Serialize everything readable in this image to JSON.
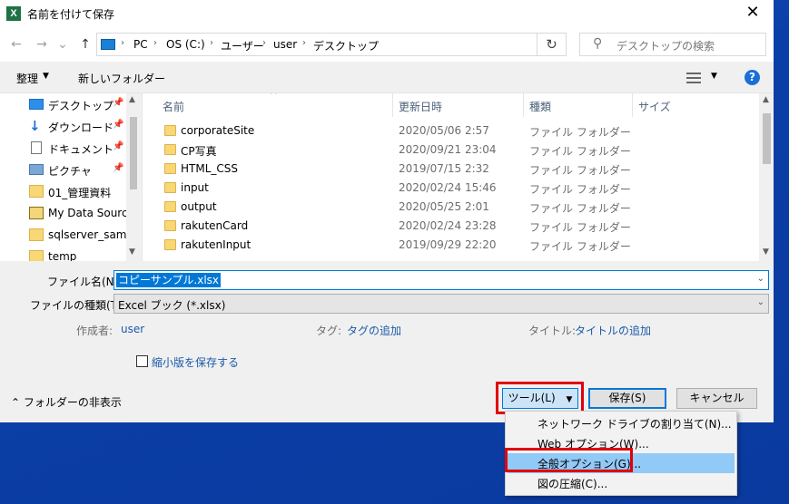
{
  "window": {
    "title": "名前を付けて保存",
    "app_icon_letter": "X",
    "close_glyph": "✕"
  },
  "nav": {
    "back": "←",
    "forward": "→",
    "recent": "⌄",
    "up": "↑",
    "breadcrumbs": [
      "PC",
      "OS (C:)",
      "ユーザー",
      "user",
      "デスクトップ"
    ],
    "separator": "›",
    "search_placeholder": "デスクトップの検索"
  },
  "toolbar": {
    "organize": "整理",
    "new_folder": "新しいフォルダー"
  },
  "sidebar": {
    "items": [
      {
        "label": "デスクトップ",
        "icon": "desktop-icon",
        "pinned": true
      },
      {
        "label": "ダウンロード",
        "icon": "download-icon",
        "pinned": true
      },
      {
        "label": "ドキュメント",
        "icon": "document-icon",
        "pinned": true
      },
      {
        "label": "ピクチャ",
        "icon": "picture-icon",
        "pinned": true
      },
      {
        "label": "01_管理資料",
        "icon": "folder-icon",
        "pinned": false
      },
      {
        "label": "My Data Sources",
        "icon": "datasource-icon",
        "pinned": false
      },
      {
        "label": "sqlserver_sample",
        "icon": "folder-icon",
        "pinned": false
      },
      {
        "label": "temp",
        "icon": "folder-icon",
        "pinned": false
      }
    ]
  },
  "files": {
    "columns": [
      "名前",
      "更新日時",
      "種類",
      "サイズ"
    ],
    "rows": [
      {
        "name": "corporateSite",
        "date": "2020/05/06 2:57",
        "type": "ファイル フォルダー"
      },
      {
        "name": "CP写真",
        "date": "2020/09/21 23:04",
        "type": "ファイル フォルダー"
      },
      {
        "name": "HTML_CSS",
        "date": "2019/07/15 2:32",
        "type": "ファイル フォルダー"
      },
      {
        "name": "input",
        "date": "2020/02/24 15:46",
        "type": "ファイル フォルダー"
      },
      {
        "name": "output",
        "date": "2020/05/25 2:01",
        "type": "ファイル フォルダー"
      },
      {
        "name": "rakutenCard",
        "date": "2020/02/24 23:28",
        "type": "ファイル フォルダー"
      },
      {
        "name": "rakutenInput",
        "date": "2019/09/29 22:20",
        "type": "ファイル フォルダー"
      }
    ]
  },
  "form": {
    "filename_label": "ファイル名(N):",
    "filename_value": "コピーサンプル.xlsx",
    "filetype_label": "ファイルの種類(T):",
    "filetype_value": "Excel ブック (*.xlsx)",
    "author_label": "作成者:",
    "author_value": "user",
    "tags_label": "タグ:",
    "tags_value": "タグの追加",
    "title_label": "タイトル:",
    "title_value": "タイトルの追加",
    "thumbnail_label": "縮小版を保存する",
    "hide_folders": "フォルダーの非表示"
  },
  "buttons": {
    "tools": "ツール(L)",
    "save": "保存(S)",
    "cancel": "キャンセル"
  },
  "tools_menu": {
    "items": [
      {
        "label": "ネットワーク ドライブの割り当て(N)...",
        "highlighted": false
      },
      {
        "label": "Web オプション(W)...",
        "highlighted": false
      },
      {
        "label": "全般オプション(G)...",
        "highlighted": true
      },
      {
        "label": "図の圧縮(C)...",
        "highlighted": false
      }
    ]
  },
  "colors": {
    "accent": "#0078d7",
    "annotation_red": "#e0000b",
    "menu_highlight": "#91c9f7"
  }
}
